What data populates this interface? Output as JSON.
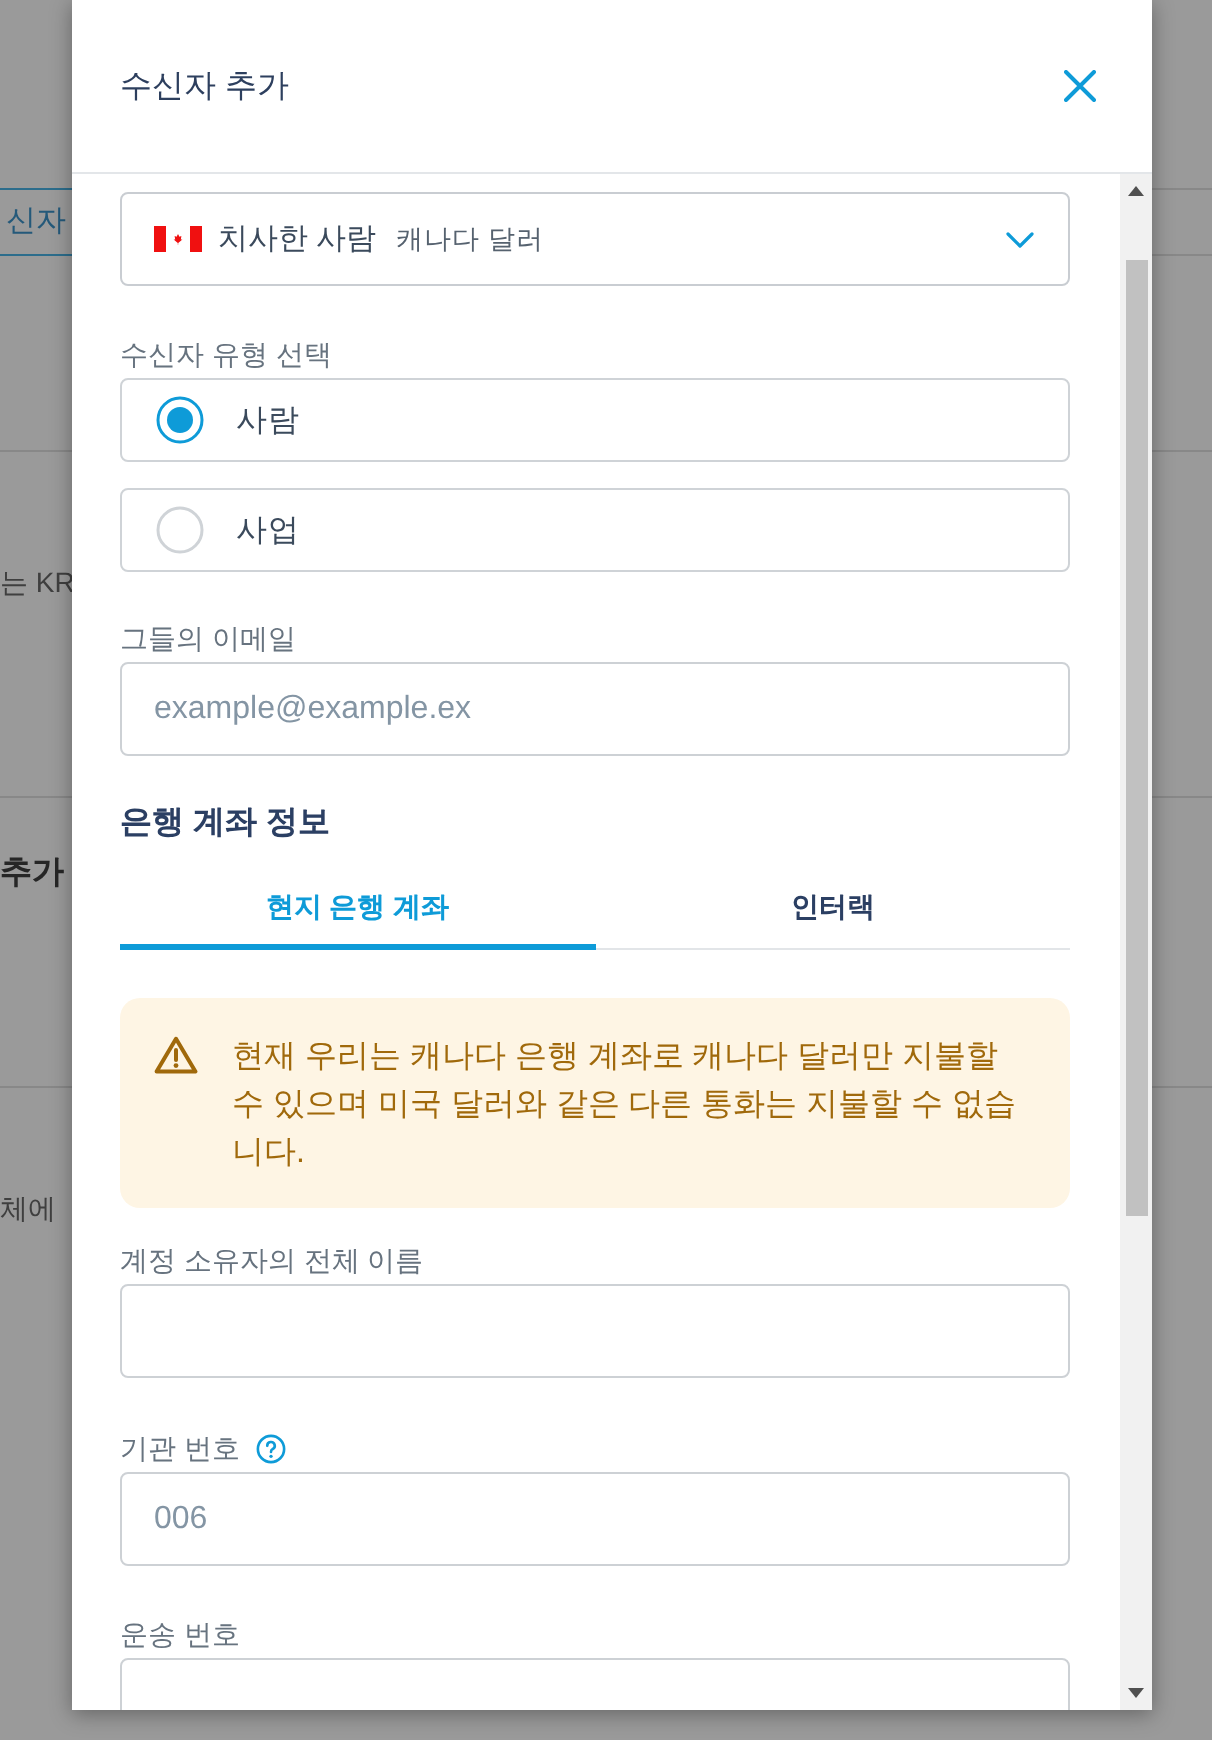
{
  "background_page": {
    "items": [
      {
        "kind": "tab",
        "text": "신자"
      },
      {
        "kind": "text",
        "text": "는 KR"
      },
      {
        "kind": "heading",
        "text": "추가"
      },
      {
        "kind": "text",
        "text": "체에"
      }
    ]
  },
  "dialog": {
    "title": "수신자 추가"
  },
  "currency_select": {
    "name": "치사한 사람",
    "currency": "캐나다 달러"
  },
  "recipient_type": {
    "label": "수신자 유형 선택",
    "options": [
      {
        "label": "사람",
        "selected": true
      },
      {
        "label": "사업",
        "selected": false
      }
    ]
  },
  "email": {
    "label": "그들의 이메일",
    "placeholder": "example@example.ex"
  },
  "bank_details": {
    "heading": "은행 계좌 정보",
    "tabs": [
      {
        "label": "현지 은행 계좌",
        "selected": true
      },
      {
        "label": "인터랙",
        "selected": false
      }
    ],
    "warning": "현재 우리는 캐나다 은행 계좌로 캐나다 달러만 지불할 수 있으며 미국 달러와 같은 다른 통화는 지불할 수 없습니다.",
    "fields": [
      {
        "label": "계정 소유자의 전체 이름",
        "help": false
      },
      {
        "label": "기관 번호",
        "help": true,
        "placeholder": "006"
      },
      {
        "label": "운송 번호",
        "help": false
      }
    ]
  }
}
